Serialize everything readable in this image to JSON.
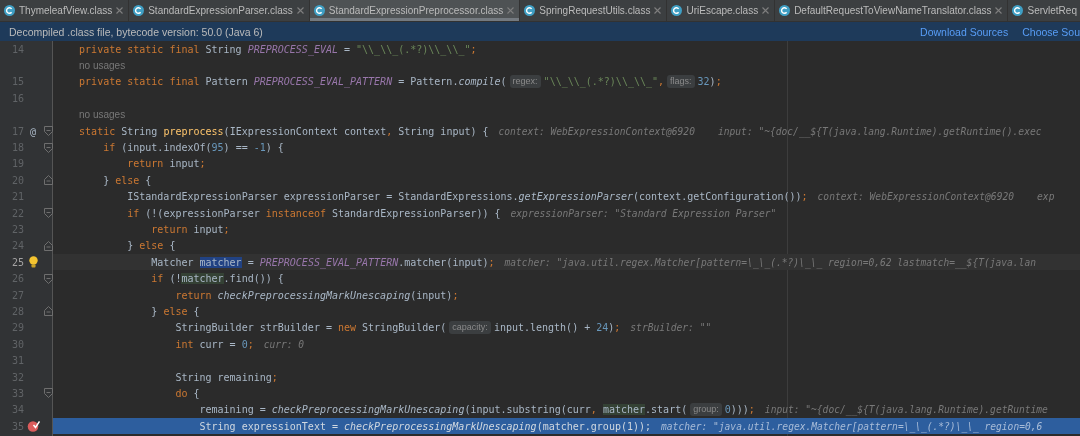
{
  "tabs": [
    {
      "label": "ThymeleafView.class",
      "selected": false
    },
    {
      "label": "StandardExpressionParser.class",
      "selected": false
    },
    {
      "label": "StandardExpressionPreprocessor.class",
      "selected": true
    },
    {
      "label": "SpringRequestUtils.class",
      "selected": false
    },
    {
      "label": "UriEscape.class",
      "selected": false
    },
    {
      "label": "DefaultRequestToViewNameTranslator.class",
      "selected": false
    },
    {
      "label": "ServletReq",
      "selected": false
    }
  ],
  "banner": {
    "message": "Decompiled .class file, bytecode version: 50.0 (Java 6)",
    "links": [
      "Download Sources",
      "Choose Sou"
    ]
  },
  "lines": [
    {
      "kind": "code",
      "number": "14",
      "caret_line": false,
      "execution_point": false,
      "breakpoint": false,
      "bulb": false,
      "fold_start": false,
      "fold_end": false,
      "tokens": [
        {
          "kind": "keyword",
          "text": "    private static final"
        },
        {
          "kind": "plain",
          "text": " String "
        },
        {
          "kind": "field",
          "text": "PREPROCESS_EVAL"
        },
        {
          "kind": "plain",
          "text": " = "
        },
        {
          "kind": "string",
          "text": "\"\\\\_\\\\_(.*?)\\\\_\\\\_\""
        },
        {
          "kind": "keyword",
          "text": ";"
        }
      ]
    },
    {
      "kind": "usage",
      "text": "no usages"
    },
    {
      "kind": "code",
      "number": "15",
      "caret_line": false,
      "execution_point": false,
      "breakpoint": false,
      "bulb": false,
      "fold_start": false,
      "fold_end": false,
      "tokens": [
        {
          "kind": "keyword",
          "text": "    private static final"
        },
        {
          "kind": "plain",
          "text": " Pattern "
        },
        {
          "kind": "field",
          "text": "PREPROCESS_EVAL_PATTERN"
        },
        {
          "kind": "plain",
          "text": " = Pattern."
        },
        {
          "kind": "static",
          "text": "compile"
        },
        {
          "kind": "plain",
          "text": "("
        },
        {
          "kind": "param",
          "text": "regex:"
        },
        {
          "kind": "string",
          "text": "\"\\\\_\\\\_(.*?)\\\\_\\\\_\""
        },
        {
          "kind": "keyword",
          "text": ","
        },
        {
          "kind": "param",
          "text": "flags:"
        },
        {
          "kind": "number",
          "text": "32"
        },
        {
          "kind": "plain",
          "text": ")"
        },
        {
          "kind": "keyword",
          "text": ";"
        }
      ]
    },
    {
      "kind": "code",
      "number": "16",
      "caret_line": false,
      "execution_point": false,
      "breakpoint": false,
      "bulb": false,
      "fold_start": false,
      "fold_end": false
    },
    {
      "kind": "usage",
      "text": "no usages"
    },
    {
      "kind": "code",
      "number": "17",
      "caret_line": false,
      "execution_point": false,
      "breakpoint": false,
      "bulb": false,
      "fold_start": true,
      "fold_end": false,
      "gutter_text": "@",
      "tokens": [
        {
          "kind": "keyword",
          "text": "    static"
        },
        {
          "kind": "plain",
          "text": " String "
        },
        {
          "kind": "method",
          "text": "preprocess"
        },
        {
          "kind": "plain",
          "text": "(IExpressionContext context"
        },
        {
          "kind": "keyword",
          "text": ","
        },
        {
          "kind": "plain",
          "text": " String input) {"
        },
        {
          "kind": "hint",
          "text": "context: WebExpressionContext@6920    input: \"~{doc/__${T(java.lang.Runtime).getRuntime().exec"
        }
      ]
    },
    {
      "kind": "code",
      "number": "18",
      "caret_line": false,
      "execution_point": false,
      "breakpoint": false,
      "bulb": false,
      "fold_start": true,
      "fold_end": false,
      "tokens": [
        {
          "kind": "keyword",
          "text": "        if"
        },
        {
          "kind": "plain",
          "text": " (input.indexOf("
        },
        {
          "kind": "number",
          "text": "95"
        },
        {
          "kind": "plain",
          "text": ") == "
        },
        {
          "kind": "number",
          "text": "-1"
        },
        {
          "kind": "plain",
          "text": ") {"
        }
      ]
    },
    {
      "kind": "code",
      "number": "19",
      "caret_line": false,
      "execution_point": false,
      "breakpoint": false,
      "bulb": false,
      "fold_start": false,
      "fold_end": false,
      "tokens": [
        {
          "kind": "keyword",
          "text": "            return"
        },
        {
          "kind": "plain",
          "text": " input"
        },
        {
          "kind": "keyword",
          "text": ";"
        }
      ]
    },
    {
      "kind": "code",
      "number": "20",
      "caret_line": false,
      "execution_point": false,
      "breakpoint": false,
      "bulb": false,
      "fold_start": false,
      "fold_end": true,
      "tokens": [
        {
          "kind": "plain",
          "text": "        } "
        },
        {
          "kind": "keyword",
          "text": "else"
        },
        {
          "kind": "plain",
          "text": " {"
        }
      ]
    },
    {
      "kind": "code",
      "number": "21",
      "caret_line": false,
      "execution_point": false,
      "breakpoint": false,
      "bulb": false,
      "fold_start": false,
      "fold_end": false,
      "tokens": [
        {
          "kind": "plain",
          "text": "            IStandardExpressionParser expressionParser = StandardExpressions."
        },
        {
          "kind": "static",
          "text": "getExpressionParser"
        },
        {
          "kind": "plain",
          "text": "(context.getConfiguration())"
        },
        {
          "kind": "keyword",
          "text": ";"
        },
        {
          "kind": "hint",
          "text": "context: WebExpressionContext@6920    exp"
        }
      ]
    },
    {
      "kind": "code",
      "number": "22",
      "caret_line": false,
      "execution_point": false,
      "breakpoint": false,
      "bulb": false,
      "fold_start": true,
      "fold_end": false,
      "tokens": [
        {
          "kind": "keyword",
          "text": "            if"
        },
        {
          "kind": "plain",
          "text": " (!(expressionParser "
        },
        {
          "kind": "keyword",
          "text": "instanceof"
        },
        {
          "kind": "plain",
          "text": " StandardExpressionParser)) {"
        },
        {
          "kind": "hint",
          "text": "expressionParser: \"Standard Expression Parser\""
        }
      ]
    },
    {
      "kind": "code",
      "number": "23",
      "caret_line": false,
      "execution_point": false,
      "breakpoint": false,
      "bulb": false,
      "fold_start": false,
      "fold_end": false,
      "tokens": [
        {
          "kind": "keyword",
          "text": "                return"
        },
        {
          "kind": "plain",
          "text": " input"
        },
        {
          "kind": "keyword",
          "text": ";"
        }
      ]
    },
    {
      "kind": "code",
      "number": "24",
      "caret_line": false,
      "execution_point": false,
      "breakpoint": false,
      "bulb": false,
      "fold_start": false,
      "fold_end": true,
      "tokens": [
        {
          "kind": "plain",
          "text": "            } "
        },
        {
          "kind": "keyword",
          "text": "else"
        },
        {
          "kind": "plain",
          "text": " {"
        }
      ]
    },
    {
      "kind": "code",
      "number": "25",
      "caret_line": true,
      "execution_point": false,
      "breakpoint": false,
      "bulb": true,
      "fold_start": false,
      "fold_end": false,
      "tokens": [
        {
          "kind": "plain",
          "text": "                Matcher "
        },
        {
          "kind": "selected",
          "text": "matcher"
        },
        {
          "kind": "plain",
          "text": " = "
        },
        {
          "kind": "field",
          "text": "PREPROCESS_EVAL_PATTERN"
        },
        {
          "kind": "plain",
          "text": ".matcher(input)"
        },
        {
          "kind": "keyword",
          "text": ";"
        },
        {
          "kind": "hint",
          "text": "matcher: \"java.util.regex.Matcher[pattern=\\_\\_(.*?)\\_\\_ region=0,62 lastmatch=__${T(java.lan"
        }
      ]
    },
    {
      "kind": "code",
      "number": "26",
      "caret_line": false,
      "execution_point": false,
      "breakpoint": false,
      "bulb": false,
      "fold_start": true,
      "fold_end": false,
      "tokens": [
        {
          "kind": "keyword",
          "text": "                if"
        },
        {
          "kind": "plain",
          "text": " (!"
        },
        {
          "kind": "usage_mark",
          "text": "matcher"
        },
        {
          "kind": "plain",
          "text": ".find()) {"
        }
      ]
    },
    {
      "kind": "code",
      "number": "27",
      "caret_line": false,
      "execution_point": false,
      "breakpoint": false,
      "bulb": false,
      "fold_start": false,
      "fold_end": false,
      "tokens": [
        {
          "kind": "keyword",
          "text": "                    return "
        },
        {
          "kind": "static",
          "text": "checkPreprocessingMarkUnescaping"
        },
        {
          "kind": "plain",
          "text": "(input)"
        },
        {
          "kind": "keyword",
          "text": ";"
        }
      ]
    },
    {
      "kind": "code",
      "number": "28",
      "caret_line": false,
      "execution_point": false,
      "breakpoint": false,
      "bulb": false,
      "fold_start": false,
      "fold_end": true,
      "tokens": [
        {
          "kind": "plain",
          "text": "                } "
        },
        {
          "kind": "keyword",
          "text": "else"
        },
        {
          "kind": "plain",
          "text": " {"
        }
      ]
    },
    {
      "kind": "code",
      "number": "29",
      "caret_line": false,
      "execution_point": false,
      "breakpoint": false,
      "bulb": false,
      "fold_start": false,
      "fold_end": false,
      "tokens": [
        {
          "kind": "plain",
          "text": "                    StringBuilder strBuilder = "
        },
        {
          "kind": "keyword",
          "text": "new"
        },
        {
          "kind": "plain",
          "text": " StringBuilder("
        },
        {
          "kind": "param",
          "text": "capacity:"
        },
        {
          "kind": "plain",
          "text": "input.length() + "
        },
        {
          "kind": "number",
          "text": "24"
        },
        {
          "kind": "plain",
          "text": ")"
        },
        {
          "kind": "keyword",
          "text": ";"
        },
        {
          "kind": "hint",
          "text": "strBuilder: \"\""
        }
      ]
    },
    {
      "kind": "code",
      "number": "30",
      "caret_line": false,
      "execution_point": false,
      "breakpoint": false,
      "bulb": false,
      "fold_start": false,
      "fold_end": false,
      "tokens": [
        {
          "kind": "keyword",
          "text": "                    int"
        },
        {
          "kind": "plain",
          "text": " curr = "
        },
        {
          "kind": "number",
          "text": "0"
        },
        {
          "kind": "keyword",
          "text": ";"
        },
        {
          "kind": "hint",
          "text": "curr: 0"
        }
      ]
    },
    {
      "kind": "code",
      "number": "31",
      "caret_line": false,
      "execution_point": false,
      "breakpoint": false,
      "bulb": false,
      "fold_start": false,
      "fold_end": false
    },
    {
      "kind": "code",
      "number": "32",
      "caret_line": false,
      "execution_point": false,
      "breakpoint": false,
      "bulb": false,
      "fold_start": false,
      "fold_end": false,
      "tokens": [
        {
          "kind": "plain",
          "text": "                    String remaining"
        },
        {
          "kind": "keyword",
          "text": ";"
        }
      ]
    },
    {
      "kind": "code",
      "number": "33",
      "caret_line": false,
      "execution_point": false,
      "breakpoint": false,
      "bulb": false,
      "fold_start": true,
      "fold_end": false,
      "tokens": [
        {
          "kind": "keyword",
          "text": "                    do"
        },
        {
          "kind": "plain",
          "text": " {"
        }
      ]
    },
    {
      "kind": "code",
      "number": "34",
      "caret_line": false,
      "execution_point": false,
      "breakpoint": false,
      "bulb": false,
      "fold_start": false,
      "fold_end": false,
      "tokens": [
        {
          "kind": "plain",
          "text": "                        remaining = "
        },
        {
          "kind": "static",
          "text": "checkPreprocessingMarkUnescaping"
        },
        {
          "kind": "plain",
          "text": "(input.substring(curr"
        },
        {
          "kind": "keyword",
          "text": ", "
        },
        {
          "kind": "usage_mark",
          "text": "matcher"
        },
        {
          "kind": "plain",
          "text": ".start("
        },
        {
          "kind": "param",
          "text": "group:"
        },
        {
          "kind": "number",
          "text": "0"
        },
        {
          "kind": "plain",
          "text": ")))"
        },
        {
          "kind": "keyword",
          "text": ";"
        },
        {
          "kind": "hint",
          "text": "input: \"~{doc/__${T(java.lang.Runtime).getRuntime"
        }
      ]
    },
    {
      "kind": "code",
      "number": "35",
      "caret_line": false,
      "execution_point": true,
      "breakpoint": true,
      "bulb": false,
      "fold_start": false,
      "fold_end": false,
      "tokens": [
        {
          "kind": "plain",
          "text": "                        String expressionText = "
        },
        {
          "kind": "static",
          "text": "checkPreprocessingMarkUnescaping"
        },
        {
          "kind": "plain",
          "text": "(matcher.group("
        },
        {
          "kind": "number",
          "text": "1"
        },
        {
          "kind": "plain",
          "text": "))"
        },
        {
          "kind": "keyword",
          "text": ";"
        },
        {
          "kind": "hint",
          "text": "matcher: \"java.util.regex.Matcher[pattern=\\_\\_(.*?)\\_\\_ region=0,6"
        }
      ]
    }
  ]
}
